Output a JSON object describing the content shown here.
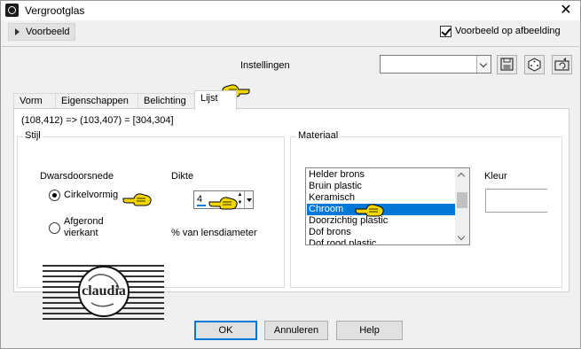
{
  "window": {
    "title": "Vergrootglas"
  },
  "header": {
    "preview_toggle_label": "Voorbeeld",
    "preview_on_image_label": "Voorbeeld op afbeelding",
    "preview_on_image_checked": true
  },
  "settings": {
    "label": "Instellingen",
    "value": ""
  },
  "toolbar_icons": [
    "save-icon",
    "dice-icon",
    "reset-icon"
  ],
  "tabs": [
    {
      "label": "Vorm"
    },
    {
      "label": "Eigenschappen"
    },
    {
      "label": "Belichting"
    },
    {
      "label": "Lijst",
      "active": true
    }
  ],
  "panel": {
    "coords": "(108,412) => (103,407) = [304,304]",
    "style_group": {
      "title": "Stijl",
      "cross_section_label": "Dwarsdoorsnede",
      "option_circular": "Cirkelvormig",
      "option_rounded_line1": "Afgerond",
      "option_rounded_line2": "vierkant",
      "selected": "Cirkelvormig",
      "thickness_label": "Dikte",
      "thickness_value": "4",
      "thickness_unit": "% van lensdiameter"
    },
    "material_group": {
      "title": "Materiaal",
      "items": [
        "Helder brons",
        "Bruin plastic",
        "Keramisch",
        "Chroom",
        "Doorzichtig plastic",
        "Dof brons",
        "Dof rood plastic"
      ],
      "selected": "Chroom",
      "color_label": "Kleur"
    }
  },
  "watermark": {
    "text": "claudia"
  },
  "buttons": {
    "ok": "OK",
    "cancel": "Annuleren",
    "help": "Help"
  },
  "colors": {
    "accent": "#0078d7",
    "hand": "#f2d600"
  }
}
